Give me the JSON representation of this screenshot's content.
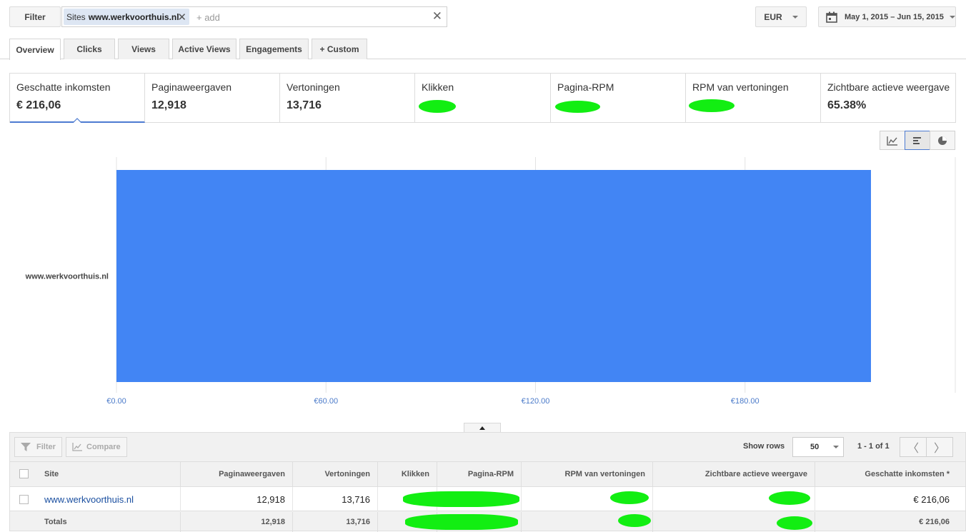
{
  "topbar": {
    "filter_label": "Filter",
    "chip_prefix": "Sites",
    "chip_value": "www.werkvoorthuis.nl",
    "add_placeholder": "+ add",
    "currency": "EUR",
    "date_range": "May 1, 2015 – Jun 15, 2015"
  },
  "tabs": [
    {
      "label": "Overview",
      "active": true
    },
    {
      "label": "Clicks"
    },
    {
      "label": "Views"
    },
    {
      "label": "Active Views"
    },
    {
      "label": "Engagements"
    },
    {
      "label": "+ Custom"
    }
  ],
  "scorecards": [
    {
      "label": "Geschatte inkomsten",
      "value": "€ 216,06",
      "selected": true
    },
    {
      "label": "Paginaweergaven",
      "value": "12,918"
    },
    {
      "label": "Vertoningen",
      "value": "13,716"
    },
    {
      "label": "Klikken",
      "value": ""
    },
    {
      "label": "Pagina-RPM",
      "value": ""
    },
    {
      "label": "RPM van vertoningen",
      "value": ""
    },
    {
      "label": "Zichtbare actieve weergave",
      "value": "65.38%"
    }
  ],
  "chart_data": {
    "type": "bar",
    "orientation": "horizontal",
    "categories": [
      "www.werkvoorthuis.nl"
    ],
    "values": [
      216.06
    ],
    "xlim": [
      0,
      216.06
    ],
    "x_ticks": [
      0,
      60,
      120,
      180
    ],
    "x_tick_labels": [
      "€0.00",
      "€60.00",
      "€120.00",
      "€180.00"
    ],
    "bar_color": "#4285f4",
    "grid": true
  },
  "table": {
    "filter_label": "Filter",
    "compare_label": "Compare",
    "show_rows_label": "Show rows",
    "rows_value": "50",
    "page_info": "1 - 1 of 1",
    "columns": [
      "Site",
      "Paginaweergaven",
      "Vertoningen",
      "Klikken",
      "Pagina-RPM",
      "RPM van vertoningen",
      "Zichtbare actieve weergave",
      "Geschatte inkomsten *"
    ],
    "row": {
      "site": "www.werkvoorthuis.nl",
      "paginaweergaven": "12,918",
      "vertoningen": "13,716",
      "inkomsten": "€ 216,06"
    },
    "totals": {
      "label": "Totals",
      "paginaweergaven": "12,918",
      "vertoningen": "13,716",
      "inkomsten": "€ 216,06"
    }
  },
  "colors": {
    "accent": "#4d7bd1",
    "bar": "#4285f4",
    "redaction": "#12ee12",
    "link": "#1a4fa0"
  }
}
